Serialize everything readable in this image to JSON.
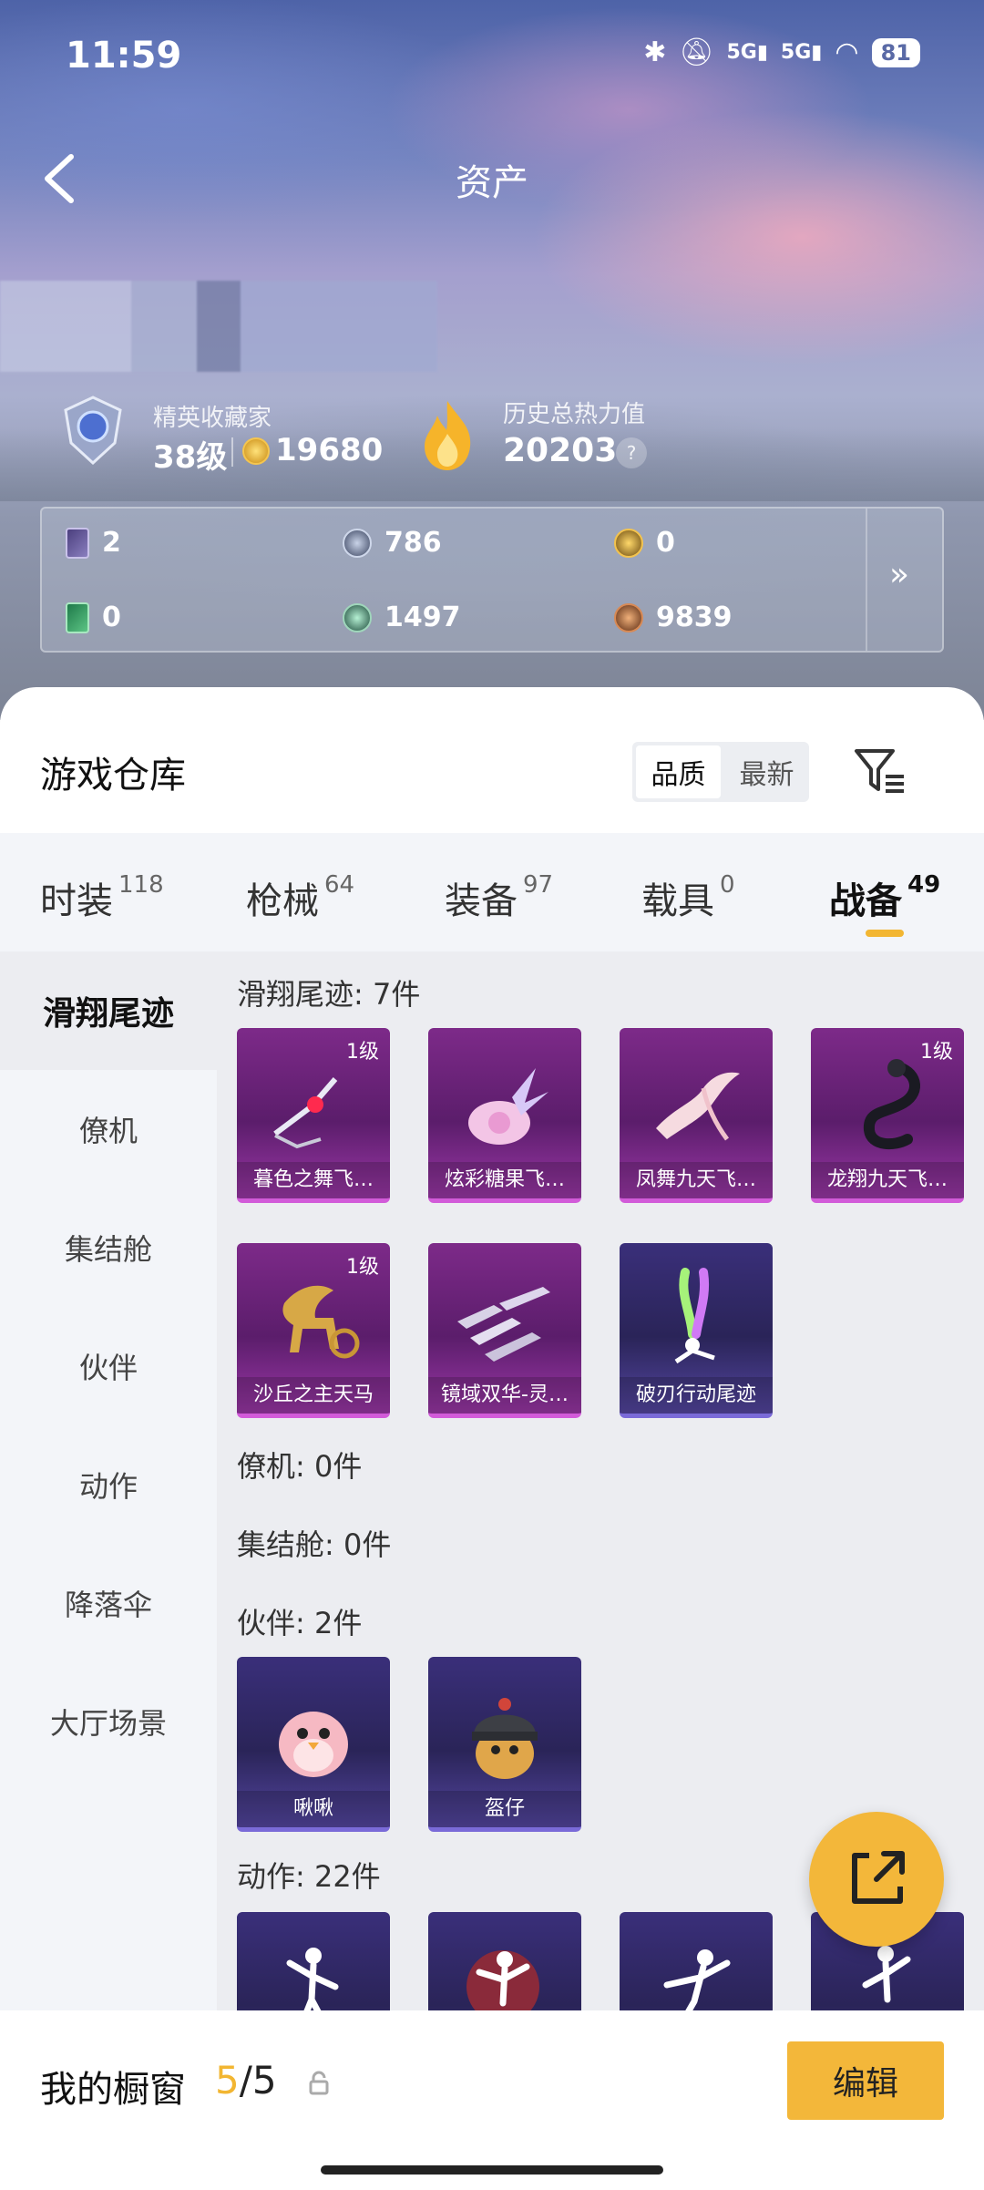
{
  "status_bar": {
    "time": "11:59",
    "network1": "5G",
    "network2": "5G",
    "battery": "81"
  },
  "header": {
    "title": "资产"
  },
  "profile": {
    "collector_title": "精英收藏家",
    "collector_level": "38级",
    "collector_points": "19680",
    "heat_title": "历史总热力值",
    "heat_value": "20203",
    "help": "?"
  },
  "currencies": [
    {
      "icon": "purple-card-icon",
      "value": "2"
    },
    {
      "icon": "silver-coin-icon",
      "value": "786"
    },
    {
      "icon": "gold-coin-icon",
      "value": "0"
    },
    {
      "icon": "green-card-icon",
      "value": "0"
    },
    {
      "icon": "green-orb-icon",
      "value": "1497"
    },
    {
      "icon": "bronze-coin-icon",
      "value": "9839"
    }
  ],
  "warehouse": {
    "title": "游戏仓库",
    "sort_options": [
      "品质",
      "最新"
    ],
    "tabs": [
      {
        "label": "时装",
        "count": "118"
      },
      {
        "label": "枪械",
        "count": "64"
      },
      {
        "label": "装备",
        "count": "97"
      },
      {
        "label": "载具",
        "count": "0"
      },
      {
        "label": "战备",
        "count": "49"
      }
    ],
    "sidebar": [
      "滑翔尾迹",
      "僚机",
      "集结舱",
      "伙伴",
      "动作",
      "降落伞",
      "大厅场景"
    ],
    "sections": {
      "trail": {
        "title": "滑翔尾迹: 7件",
        "items": [
          {
            "label": "暮色之舞飞…",
            "level": "1级"
          },
          {
            "label": "炫彩糖果飞…",
            "level": ""
          },
          {
            "label": "凤舞九天飞…",
            "level": ""
          },
          {
            "label": "龙翔九天飞…",
            "level": "1级"
          },
          {
            "label": "沙丘之主天马",
            "level": "1级"
          },
          {
            "label": "镜域双华-灵…",
            "level": ""
          },
          {
            "label": "破刃行动尾迹",
            "level": ""
          }
        ]
      },
      "wingman": {
        "title": "僚机: 0件"
      },
      "capsule": {
        "title": "集结舱: 0件"
      },
      "partner": {
        "title": "伙伴: 2件",
        "items": [
          {
            "label": "啾啾"
          },
          {
            "label": "盔仔"
          }
        ]
      },
      "emote": {
        "title": "动作: 22件"
      }
    }
  },
  "showcase": {
    "label": "我的橱窗",
    "current": "5",
    "total": "/5",
    "edit": "编辑"
  },
  "colors": {
    "accent": "#f3b73a",
    "purple_rarity": "#d25bd9",
    "blue_rarity": "#7a6ad8"
  }
}
